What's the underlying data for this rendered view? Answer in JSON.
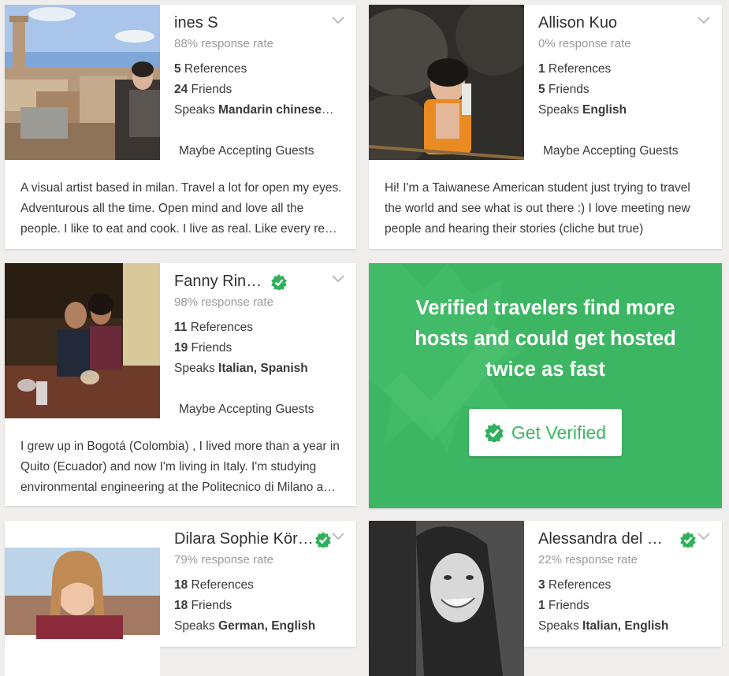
{
  "colors": {
    "accent_green": "#3db663",
    "verified_green": "#2fb15c",
    "background": "#efeeec"
  },
  "icons": {
    "verified": "verified-badge-icon",
    "expand": "chevron-down-icon"
  },
  "cards": [
    {
      "name": "ines S",
      "rate": "88% response rate",
      "references_count": "5",
      "references_label": " References",
      "friends_count": "24",
      "friends_label": " Friends",
      "speaks_prefix": "Speaks ",
      "languages": "Mandarin chinese, ...",
      "status": "Maybe Accepting Guests",
      "about": "A visual artist based in milan. Travel a lot for open my eyes. Adventurous all the time. Open mind and love all the people. I like to eat and cook. I live as real. Like every real person would."
    },
    {
      "name": "Allison Kuo",
      "rate": "0% response rate",
      "references_count": "1",
      "references_label": " References",
      "friends_count": "5",
      "friends_label": " Friends",
      "speaks_prefix": "Speaks ",
      "languages": "English",
      "status": "Maybe Accepting Guests",
      "about": "Hi! I'm a Taiwanese American student just trying to travel the world and see what is out there :) I love meeting new people and hearing their stories (cliche but true)"
    },
    {
      "name": "Fanny Rincón",
      "rate": "98% response rate",
      "references_count": "11",
      "references_label": " References",
      "friends_count": "19",
      "friends_label": " Friends",
      "speaks_prefix": "Speaks ",
      "languages": "Italian, Spanish",
      "status": "Maybe Accepting Guests",
      "about": "I grew up in Bogotá (Colombia) , I lived more than a year in Quito (Ecuador) and now I'm living in Italy. I'm studying environmental engineering at the Politecnico di Milano and I love it."
    },
    {
      "name": "Dilara Sophie Körtge",
      "rate": "79% response rate",
      "references_count": "18",
      "references_label": " References",
      "friends_count": "18",
      "friends_label": " Friends",
      "speaks_prefix": "Speaks ",
      "languages": "German, English"
    },
    {
      "name": "Alessandra del Fonte",
      "rate": "22% response rate",
      "references_count": "3",
      "references_label": " References",
      "friends_count": "1",
      "friends_label": " Friends",
      "speaks_prefix": "Speaks ",
      "languages": "Italian, English"
    }
  ],
  "promo": {
    "title": "Verified travelers find more hosts and could get hosted twice as fast",
    "button_label": "Get Verified"
  }
}
